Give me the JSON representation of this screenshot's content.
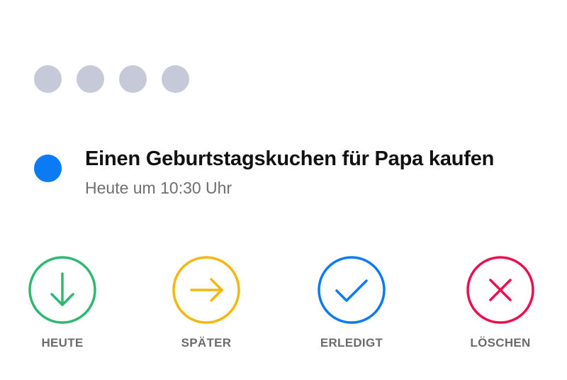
{
  "header": {
    "dots_count": 4,
    "dot_color": "#c6cad8"
  },
  "task": {
    "title": "Einen Geburtstagskuchen für Papa kaufen",
    "time": "Heute um 10:30 Uhr",
    "indicator_color": "#0a7bf5"
  },
  "actions": [
    {
      "label": "HEUTE",
      "icon": "arrow-down-icon",
      "color": "#2eb872"
    },
    {
      "label": "SPÄTER",
      "icon": "arrow-right-icon",
      "color": "#f5b70f"
    },
    {
      "label": "ERLEDIGT",
      "icon": "checkmark-icon",
      "color": "#0a7bf5"
    },
    {
      "label": "LÖSCHEN",
      "icon": "close-icon",
      "color": "#ec0f4f"
    }
  ]
}
